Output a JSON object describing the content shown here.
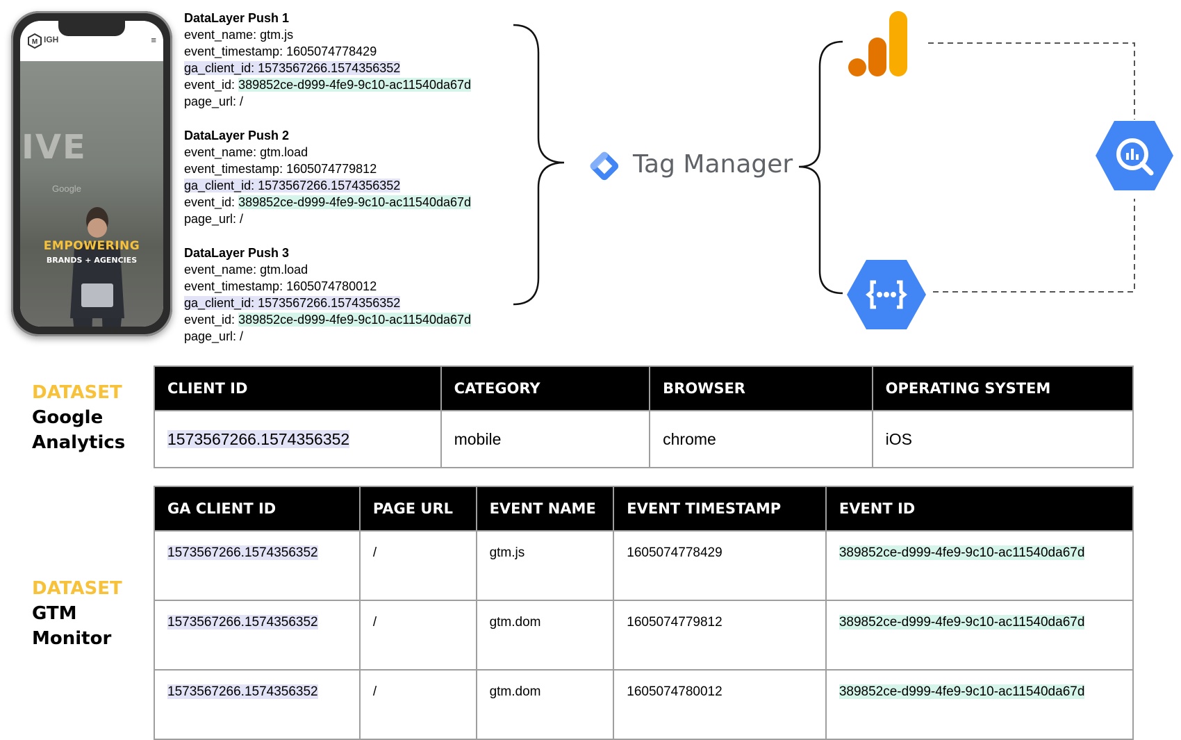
{
  "phone": {
    "brand": "IGH",
    "menu_icon": "≡",
    "hero_bg_text": "IVE",
    "hero_google": "Google",
    "headline": "EMPOWERING",
    "subheadline": "BRANDS + AGENCIES"
  },
  "pushes": [
    {
      "title": "DataLayer Push 1",
      "event_name": "event_name: gtm.js",
      "event_timestamp": "event_timestamp: 1605074778429",
      "ga_client_id": "ga_client_id: 1573567266.1574356352",
      "event_id_label": "event_id: ",
      "event_id_value": "389852ce-d999-4fe9-9c10-ac11540da67d",
      "page_url": "page_url: /"
    },
    {
      "title": "DataLayer Push 2",
      "event_name": "event_name: gtm.load",
      "event_timestamp": "event_timestamp: 1605074779812",
      "ga_client_id": "ga_client_id: 1573567266.1574356352",
      "event_id_label": "event_id: ",
      "event_id_value": "389852ce-d999-4fe9-9c10-ac11540da67d",
      "page_url": "page_url: /"
    },
    {
      "title": "DataLayer Push 3",
      "event_name": "event_name: gtm.load",
      "event_timestamp": "event_timestamp: 1605074780012",
      "ga_client_id": "ga_client_id: 1573567266.1574356352",
      "event_id_label": "event_id: ",
      "event_id_value": "389852ce-d999-4fe9-9c10-ac11540da67d",
      "page_url": "page_url: /"
    }
  ],
  "tag_manager": {
    "label": "Tag Manager"
  },
  "icons": {
    "analytics": "google-analytics-icon",
    "bigquery": "bigquery-icon",
    "cloud_functions": "cloud-functions-icon",
    "tag_manager": "tag-manager-icon"
  },
  "colors": {
    "highlight_client_id": "#e3e3f7",
    "highlight_event_id": "#d5f4ea",
    "dataset_keyword": "#f7c23a",
    "gcp_blue": "#4285f4",
    "ga_orange": "#f9ab00",
    "ga_dark_orange": "#e37400"
  },
  "dataset_ga": {
    "keyword": "DATASET",
    "line1": "Google",
    "line2": "Analytics"
  },
  "dataset_gtm": {
    "keyword": "DATASET",
    "line1": "GTM",
    "line2": "Monitor"
  },
  "table_ga": {
    "headers": [
      "CLIENT ID",
      "CATEGORY",
      "BROWSER",
      "OPERATING SYSTEM"
    ],
    "rows": [
      [
        "1573567266.1574356352",
        "mobile",
        "chrome",
        "iOS"
      ]
    ]
  },
  "table_gtm": {
    "headers": [
      "GA CLIENT ID",
      "PAGE URL",
      "EVENT NAME",
      "EVENT TIMESTAMP",
      "EVENT ID"
    ],
    "rows": [
      [
        "1573567266.1574356352",
        "/",
        "gtm.js",
        "1605074778429",
        "389852ce-d999-4fe9-9c10-ac11540da67d"
      ],
      [
        "1573567266.1574356352",
        "/",
        "gtm.dom",
        "1605074779812",
        "389852ce-d999-4fe9-9c10-ac11540da67d"
      ],
      [
        "1573567266.1574356352",
        "/",
        "gtm.dom",
        "1605074780012",
        "389852ce-d999-4fe9-9c10-ac11540da67d"
      ]
    ]
  }
}
